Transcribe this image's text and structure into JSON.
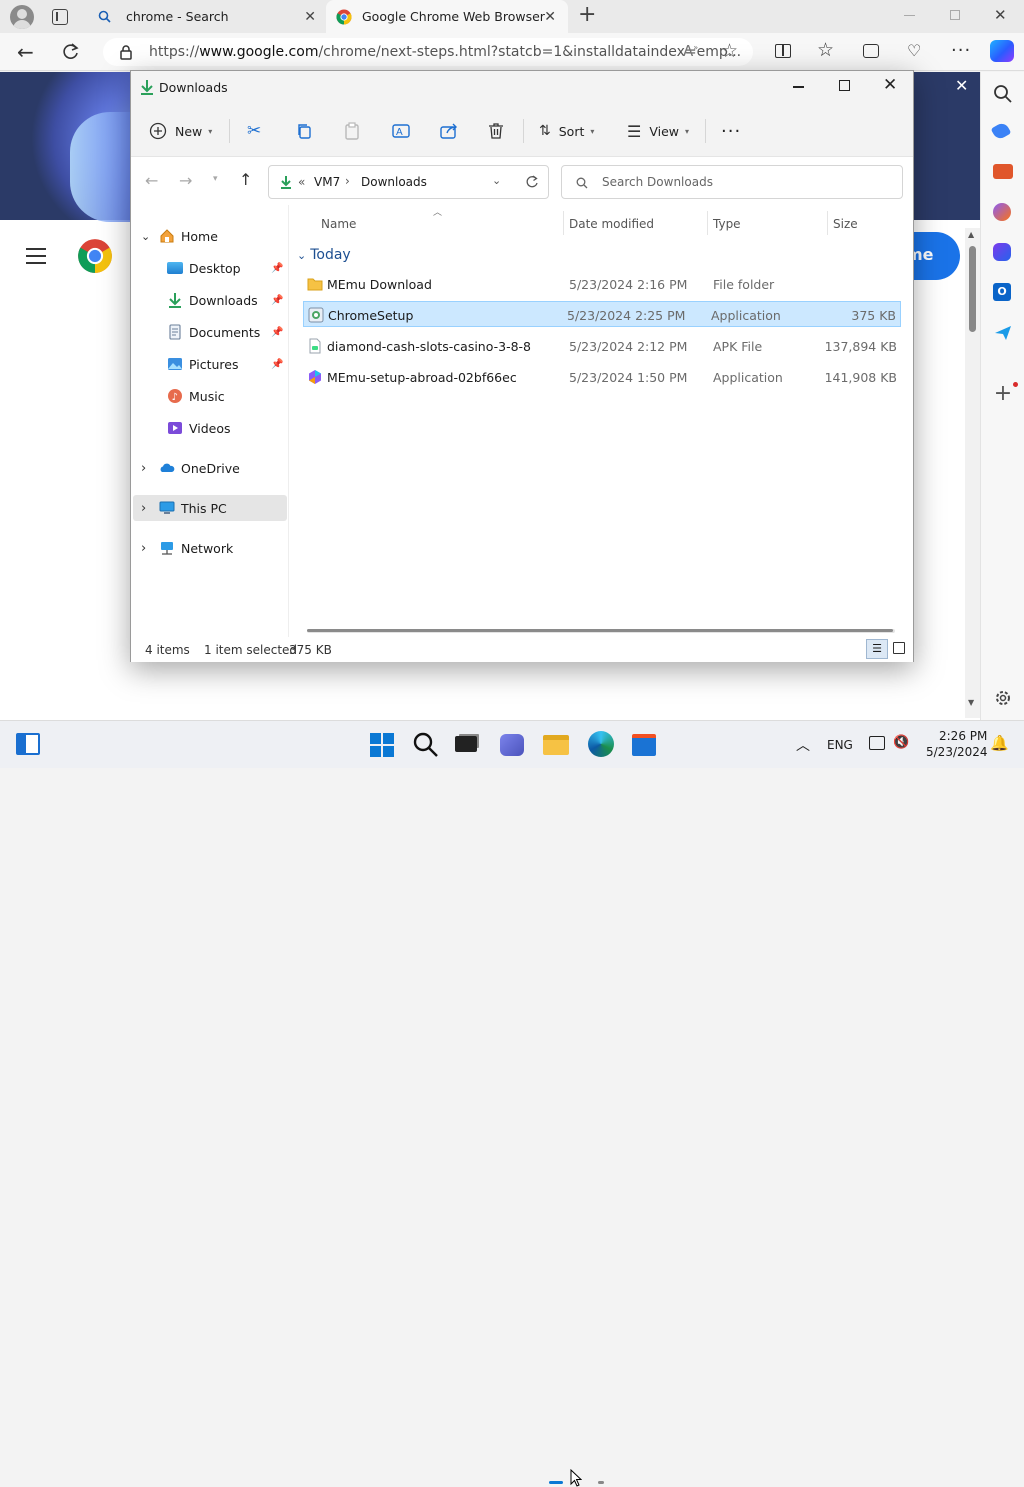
{
  "browser": {
    "tabs": [
      {
        "label": "chrome - Search"
      },
      {
        "label": "Google Chrome Web Browser"
      }
    ],
    "url": {
      "prefix": "https://",
      "domain": "www.google.com",
      "path": "/chrome/next-steps.html?statcb=1&installdataindex=emp..."
    },
    "page_button_partial": "me"
  },
  "explorer": {
    "title": "Downloads",
    "toolbar": {
      "new_label": "New",
      "sort_label": "Sort",
      "view_label": "View"
    },
    "breadcrumb": {
      "prefix": "«",
      "parts": [
        "VM7",
        "Downloads"
      ]
    },
    "search_placeholder": "Search Downloads",
    "sidebar": [
      {
        "label": "Home"
      },
      {
        "label": "Desktop"
      },
      {
        "label": "Downloads"
      },
      {
        "label": "Documents"
      },
      {
        "label": "Pictures"
      },
      {
        "label": "Music"
      },
      {
        "label": "Videos"
      },
      {
        "label": "OneDrive"
      },
      {
        "label": "This PC"
      },
      {
        "label": "Network"
      }
    ],
    "columns": [
      "Name",
      "Date modified",
      "Type",
      "Size"
    ],
    "group": "Today",
    "files": [
      {
        "name": "MEmu Download",
        "date": "5/23/2024 2:16 PM",
        "type": "File folder",
        "size": ""
      },
      {
        "name": "ChromeSetup",
        "date": "5/23/2024 2:25 PM",
        "type": "Application",
        "size": "375 KB"
      },
      {
        "name": "diamond-cash-slots-casino-3-8-8",
        "date": "5/23/2024 2:12 PM",
        "type": "APK File",
        "size": "137,894 KB"
      },
      {
        "name": "MEmu-setup-abroad-02bf66ec",
        "date": "5/23/2024 1:50 PM",
        "type": "Application",
        "size": "141,908 KB"
      }
    ],
    "status": {
      "items": "4 items",
      "selected": "1 item selected",
      "size": "375 KB"
    }
  },
  "taskbar": {
    "lang": "ENG",
    "time": "2:26 PM",
    "date": "5/23/2024"
  },
  "colors": {
    "accent": "#0067c0",
    "selection": "#cce8ff",
    "selection_border": "#99d1ff",
    "folder": "#f6c244"
  }
}
